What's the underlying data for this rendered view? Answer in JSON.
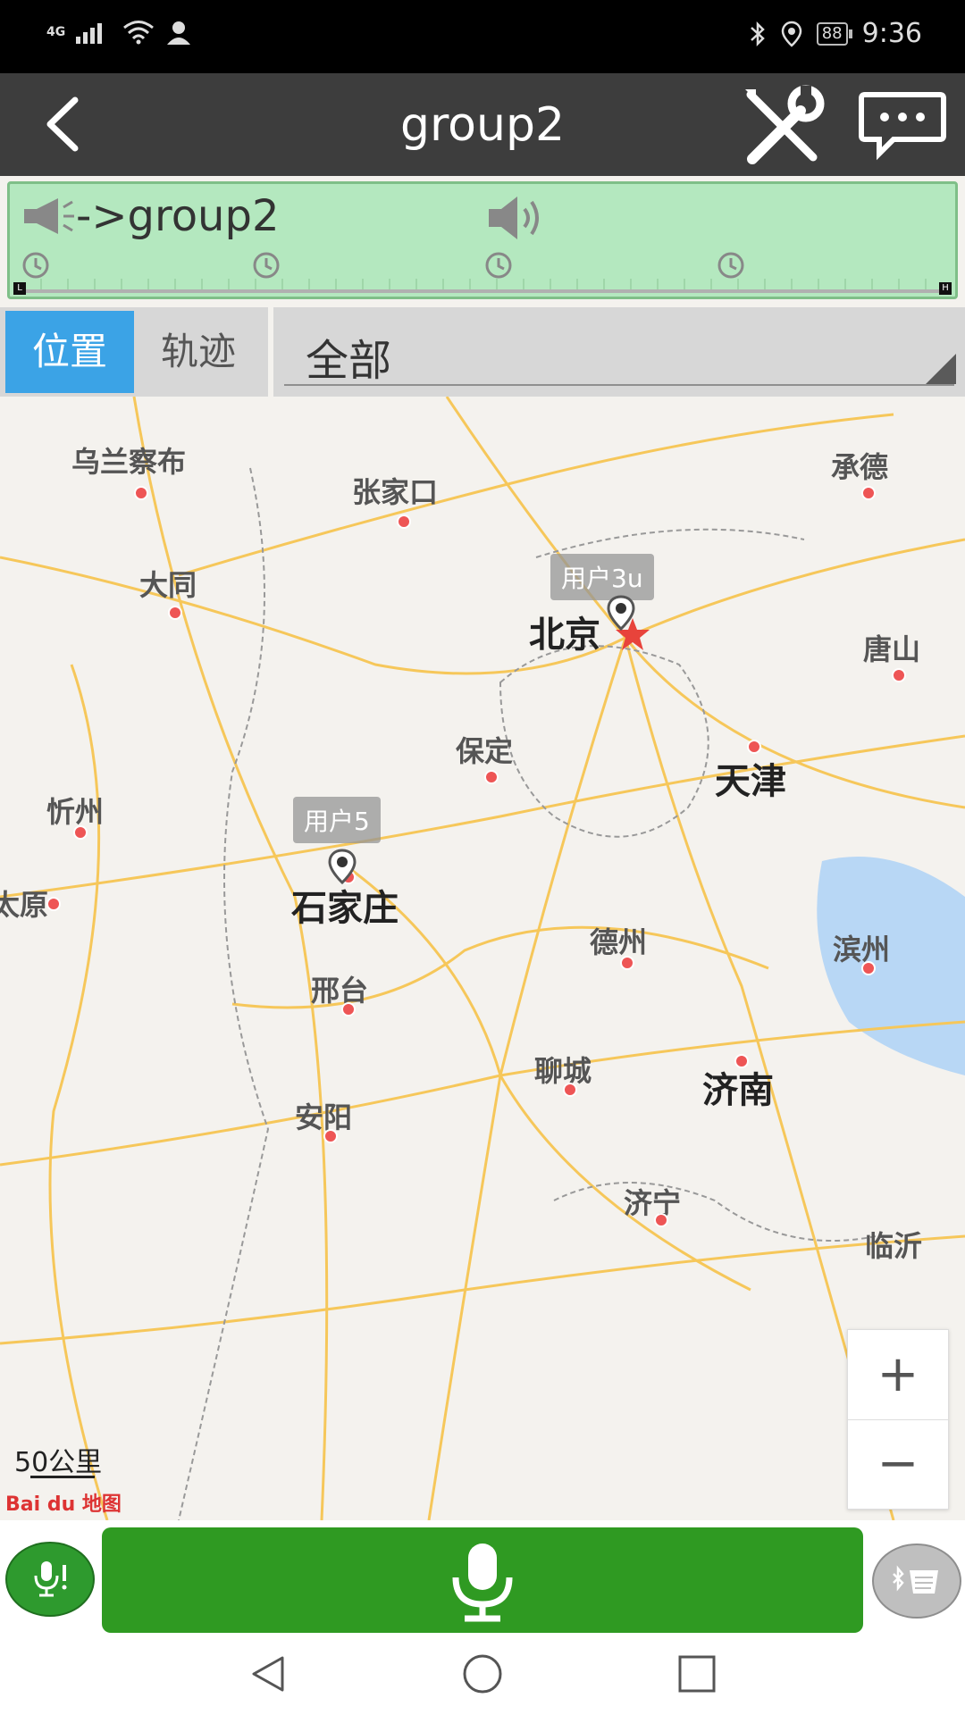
{
  "statusbar": {
    "network": "4G",
    "battery": "88",
    "time": "9:36",
    "icons": [
      "signal-icon",
      "wifi-icon",
      "user-icon",
      "bluetooth-icon",
      "location-icon",
      "battery-icon"
    ]
  },
  "titlebar": {
    "title": "group2"
  },
  "ptt_panel": {
    "label": "->group2",
    "background": "#b4e8bf"
  },
  "tabs": {
    "position": "位置",
    "track": "轨迹",
    "active_color": "#3ba3e6"
  },
  "filter": {
    "selected": "全部"
  },
  "map": {
    "cities": [
      {
        "name": "乌兰察布",
        "major": false
      },
      {
        "name": "张家口",
        "major": false
      },
      {
        "name": "承德",
        "major": false
      },
      {
        "name": "大同",
        "major": false
      },
      {
        "name": "北京",
        "major": true
      },
      {
        "name": "唐山",
        "major": false
      },
      {
        "name": "保定",
        "major": false
      },
      {
        "name": "天津",
        "major": true
      },
      {
        "name": "忻州",
        "major": false
      },
      {
        "name": "太原",
        "major": false
      },
      {
        "name": "石家庄",
        "major": true
      },
      {
        "name": "德州",
        "major": false
      },
      {
        "name": "滨州",
        "major": false
      },
      {
        "name": "邢台",
        "major": false
      },
      {
        "name": "聊城",
        "major": false
      },
      {
        "name": "济南",
        "major": true
      },
      {
        "name": "安阳",
        "major": false
      },
      {
        "name": "济宁",
        "major": false
      },
      {
        "name": "临沂",
        "major": false
      }
    ],
    "users": [
      {
        "label": "用户3u"
      },
      {
        "label": "用户5"
      }
    ],
    "scale": "50公里",
    "logo": "Bai du 地图"
  },
  "zoom": {
    "in": "+",
    "out": "−"
  },
  "colors": {
    "ptt_button": "#2f9a22",
    "titlebar": "#3d3d3d"
  }
}
